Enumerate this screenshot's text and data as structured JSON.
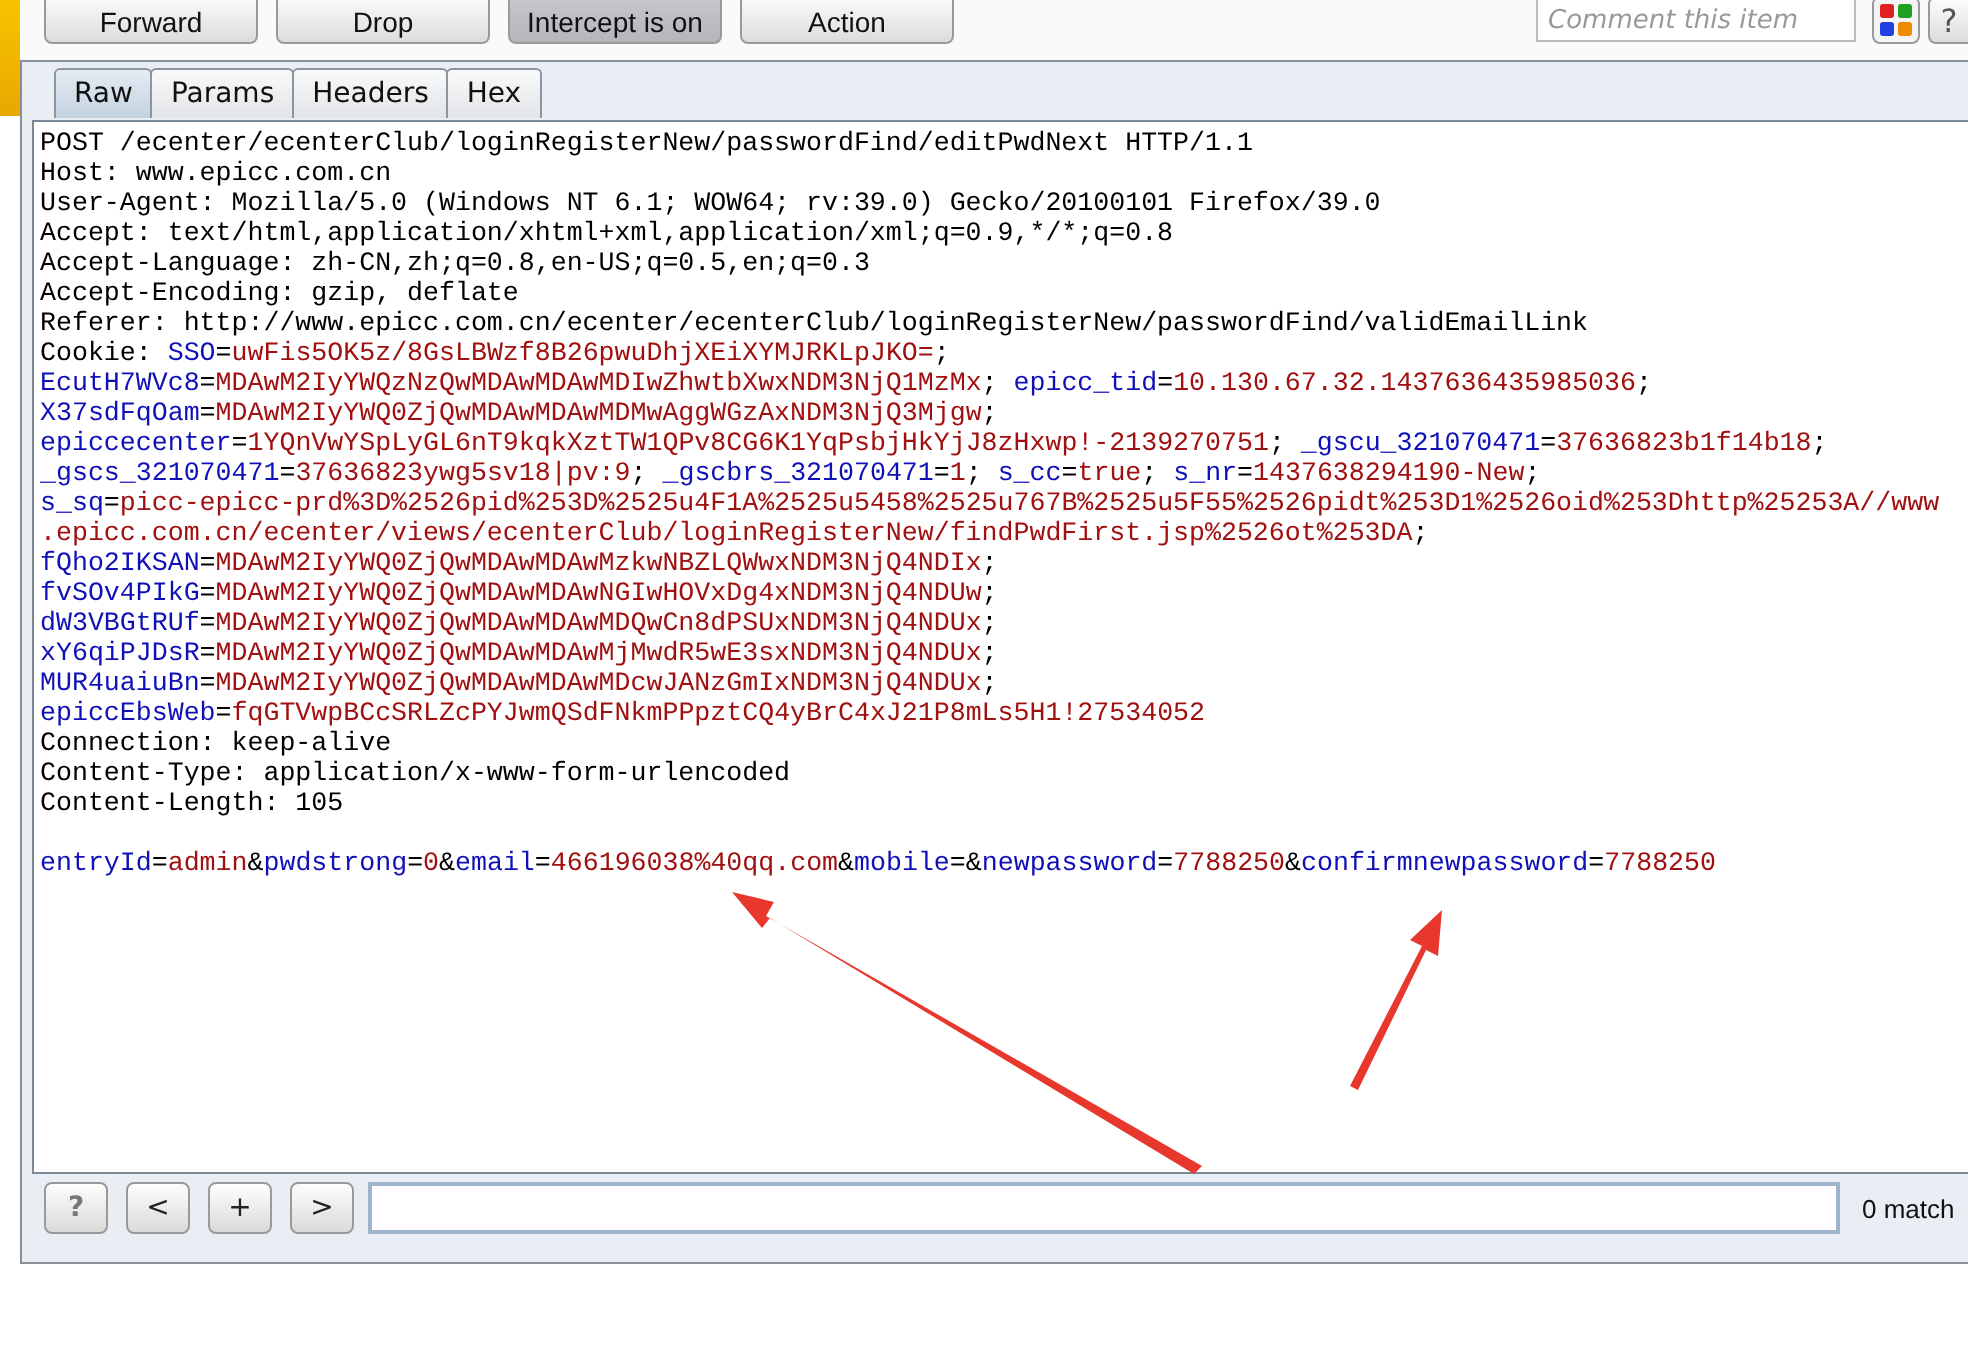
{
  "toolbar": {
    "buttons": [
      {
        "label": "Forward",
        "pressed": false
      },
      {
        "label": "Drop",
        "pressed": false
      },
      {
        "label": "Intercept is on",
        "pressed": true
      },
      {
        "label": "Action",
        "pressed": false
      }
    ],
    "comment": {
      "placeholder": "Comment this item"
    },
    "help": "?"
  },
  "tabs": [
    {
      "label": "Raw",
      "selected": true
    },
    {
      "label": "Params",
      "selected": false
    },
    {
      "label": "Headers",
      "selected": false
    },
    {
      "label": "Hex",
      "selected": false
    }
  ],
  "request": {
    "lines": [
      [
        {
          "kind": "plain",
          "text": "POST /ecenter/ecenterClub/loginRegisterNew/passwordFind/editPwdNext HTTP/1.1"
        }
      ],
      [
        {
          "kind": "plain",
          "text": "Host: www.epicc.com.cn"
        }
      ],
      [
        {
          "kind": "plain",
          "text": "User-Agent: Mozilla/5.0 (Windows NT 6.1; WOW64; rv:39.0) Gecko/20100101 Firefox/39.0"
        }
      ],
      [
        {
          "kind": "plain",
          "text": "Accept: text/html,application/xhtml+xml,application/xml;q=0.9,*/*;q=0.8"
        }
      ],
      [
        {
          "kind": "plain",
          "text": "Accept-Language: zh-CN,zh;q=0.8,en-US;q=0.5,en;q=0.3"
        }
      ],
      [
        {
          "kind": "plain",
          "text": "Accept-Encoding: gzip, deflate"
        }
      ],
      [
        {
          "kind": "plain",
          "text": "Referer: http://www.epicc.com.cn/ecenter/ecenterClub/loginRegisterNew/passwordFind/validEmailLink"
        }
      ],
      [
        {
          "kind": "plain",
          "text": "Cookie: "
        },
        {
          "kind": "name",
          "text": "SSO"
        },
        {
          "kind": "plain",
          "text": "="
        },
        {
          "kind": "value",
          "text": "uwFis5OK5z/8GsLBWzf8B26pwuDhjXEiXYMJRKLpJKO="
        },
        {
          "kind": "plain",
          "text": ";"
        }
      ],
      [
        {
          "kind": "name",
          "text": "EcutH7WVc8"
        },
        {
          "kind": "plain",
          "text": "="
        },
        {
          "kind": "value",
          "text": "MDAwM2IyYWQzNzQwMDAwMDAwMDIwZhwtbXwxNDM3NjQ1MzMx"
        },
        {
          "kind": "plain",
          "text": "; "
        },
        {
          "kind": "name",
          "text": "epicc_tid"
        },
        {
          "kind": "plain",
          "text": "="
        },
        {
          "kind": "value",
          "text": "10.130.67.32.1437636435985036"
        },
        {
          "kind": "plain",
          "text": ";"
        }
      ],
      [
        {
          "kind": "name",
          "text": "X37sdFqOam"
        },
        {
          "kind": "plain",
          "text": "="
        },
        {
          "kind": "value",
          "text": "MDAwM2IyYWQ0ZjQwMDAwMDAwMDMwAggWGzAxNDM3NjQ3Mjgw"
        },
        {
          "kind": "plain",
          "text": ";"
        }
      ],
      [
        {
          "kind": "name",
          "text": "epiccecenter"
        },
        {
          "kind": "plain",
          "text": "="
        },
        {
          "kind": "value",
          "text": "1YQnVwYSpLyGL6nT9kqkXztTW1QPv8CG6K1YqPsbjHkYjJ8zHxwp!-2139270751"
        },
        {
          "kind": "plain",
          "text": "; "
        },
        {
          "kind": "name",
          "text": "_gscu_321070471"
        },
        {
          "kind": "plain",
          "text": "="
        },
        {
          "kind": "value",
          "text": "37636823b1f14b18"
        },
        {
          "kind": "plain",
          "text": ";"
        }
      ],
      [
        {
          "kind": "name",
          "text": "_gscs_321070471"
        },
        {
          "kind": "plain",
          "text": "="
        },
        {
          "kind": "value",
          "text": "37636823ywg5sv18|pv:9"
        },
        {
          "kind": "plain",
          "text": "; "
        },
        {
          "kind": "name",
          "text": "_gscbrs_321070471"
        },
        {
          "kind": "plain",
          "text": "="
        },
        {
          "kind": "value",
          "text": "1"
        },
        {
          "kind": "plain",
          "text": "; "
        },
        {
          "kind": "name",
          "text": "s_cc"
        },
        {
          "kind": "plain",
          "text": "="
        },
        {
          "kind": "value",
          "text": "true"
        },
        {
          "kind": "plain",
          "text": "; "
        },
        {
          "kind": "name",
          "text": "s_nr"
        },
        {
          "kind": "plain",
          "text": "="
        },
        {
          "kind": "value",
          "text": "1437638294190-New"
        },
        {
          "kind": "plain",
          "text": ";"
        }
      ],
      [
        {
          "kind": "name",
          "text": "s_sq"
        },
        {
          "kind": "plain",
          "text": "="
        },
        {
          "kind": "value",
          "text": "picc-epicc-prd%3D%2526pid%253D%2525u4F1A%2525u5458%2525u767B%2525u5F55%2526pidt%253D1%2526oid%253Dhttp%25253A//www"
        }
      ],
      [
        {
          "kind": "value",
          "text": ".epicc.com.cn/ecenter/views/ecenterClub/loginRegisterNew/findPwdFirst.jsp%2526ot%253DA"
        },
        {
          "kind": "plain",
          "text": ";"
        }
      ],
      [
        {
          "kind": "name",
          "text": "fQho2IKSAN"
        },
        {
          "kind": "plain",
          "text": "="
        },
        {
          "kind": "value",
          "text": "MDAwM2IyYWQ0ZjQwMDAwMDAwMzkwNBZLQWwxNDM3NjQ4NDIx"
        },
        {
          "kind": "plain",
          "text": ";"
        }
      ],
      [
        {
          "kind": "name",
          "text": "fvSOv4PIkG"
        },
        {
          "kind": "plain",
          "text": "="
        },
        {
          "kind": "value",
          "text": "MDAwM2IyYWQ0ZjQwMDAwMDAwNGIwHOVxDg4xNDM3NjQ4NDUw"
        },
        {
          "kind": "plain",
          "text": ";"
        }
      ],
      [
        {
          "kind": "name",
          "text": "dW3VBGtRUf"
        },
        {
          "kind": "plain",
          "text": "="
        },
        {
          "kind": "value",
          "text": "MDAwM2IyYWQ0ZjQwMDAwMDAwMDQwCn8dPSUxNDM3NjQ4NDUx"
        },
        {
          "kind": "plain",
          "text": ";"
        }
      ],
      [
        {
          "kind": "name",
          "text": "xY6qiPJDsR"
        },
        {
          "kind": "plain",
          "text": "="
        },
        {
          "kind": "value",
          "text": "MDAwM2IyYWQ0ZjQwMDAwMDAwMjMwdR5wE3sxNDM3NjQ4NDUx"
        },
        {
          "kind": "plain",
          "text": ";"
        }
      ],
      [
        {
          "kind": "name",
          "text": "MUR4uaiuBn"
        },
        {
          "kind": "plain",
          "text": "="
        },
        {
          "kind": "value",
          "text": "MDAwM2IyYWQ0ZjQwMDAwMDAwMDcwJANzGmIxNDM3NjQ4NDUx"
        },
        {
          "kind": "plain",
          "text": ";"
        }
      ],
      [
        {
          "kind": "name",
          "text": "epiccEbsWeb"
        },
        {
          "kind": "plain",
          "text": "="
        },
        {
          "kind": "value",
          "text": "fqGTVwpBCcSRLZcPYJwmQSdFNkmPPpztCQ4yBrC4xJ21P8mLs5H1!27534052"
        }
      ],
      [
        {
          "kind": "plain",
          "text": "Connection: keep-alive"
        }
      ],
      [
        {
          "kind": "plain",
          "text": "Content-Type: application/x-www-form-urlencoded"
        }
      ],
      [
        {
          "kind": "plain",
          "text": "Content-Length: 105"
        }
      ]
    ],
    "body": [
      {
        "kind": "name",
        "text": "entryId"
      },
      {
        "kind": "plain",
        "text": "="
      },
      {
        "kind": "value",
        "text": "admin"
      },
      {
        "kind": "plain",
        "text": "&"
      },
      {
        "kind": "name",
        "text": "pwdstrong"
      },
      {
        "kind": "plain",
        "text": "="
      },
      {
        "kind": "value",
        "text": "0"
      },
      {
        "kind": "plain",
        "text": "&"
      },
      {
        "kind": "name",
        "text": "email"
      },
      {
        "kind": "plain",
        "text": "="
      },
      {
        "kind": "value",
        "text": "466196038%40qq.com"
      },
      {
        "kind": "plain",
        "text": "&"
      },
      {
        "kind": "name",
        "text": "mobile"
      },
      {
        "kind": "plain",
        "text": "=&"
      },
      {
        "kind": "name",
        "text": "newpassword"
      },
      {
        "kind": "plain",
        "text": "="
      },
      {
        "kind": "value",
        "text": "7788250"
      },
      {
        "kind": "plain",
        "text": "&"
      },
      {
        "kind": "name",
        "text": "confirmnewpassword"
      },
      {
        "kind": "plain",
        "text": "="
      },
      {
        "kind": "value",
        "text": "7788250"
      }
    ]
  },
  "search": {
    "buttons": [
      "?",
      "<",
      "+",
      ">"
    ],
    "matches": "0 match"
  }
}
